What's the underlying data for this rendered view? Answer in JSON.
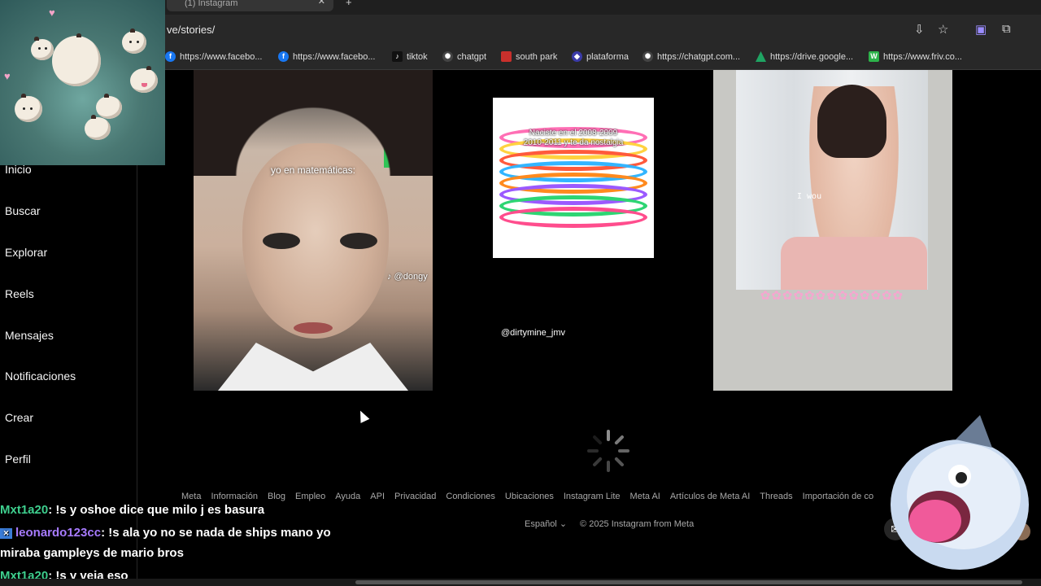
{
  "browser": {
    "tab_title": "(1) Instagram",
    "url": "ve/stories/",
    "bookmarks": [
      {
        "label": "https://www.facebo...",
        "icon": "facebook-icon",
        "color": "#1877f2"
      },
      {
        "label": "https://www.facebo...",
        "icon": "facebook-icon",
        "color": "#1877f2"
      },
      {
        "label": "tiktok",
        "icon": "tiktok-icon",
        "color": "#111111"
      },
      {
        "label": "chatgpt",
        "icon": "chatgpt-icon",
        "color": "#444444"
      },
      {
        "label": "south park",
        "icon": "south-park-icon",
        "color": "#c9302c"
      },
      {
        "label": "plataforma",
        "icon": "plataforma-icon",
        "color": "#3a3aa8"
      },
      {
        "label": "https://chatgpt.com...",
        "icon": "chatgpt-icon",
        "color": "#444444"
      },
      {
        "label": "https://drive.google...",
        "icon": "google-drive-icon",
        "color": "#1fa463"
      },
      {
        "label": "https://www.friv.co...",
        "icon": "friv-icon",
        "color": "#2db34a"
      }
    ]
  },
  "sidebar": {
    "items": [
      {
        "label": "Inicio"
      },
      {
        "label": "Buscar"
      },
      {
        "label": "Explorar"
      },
      {
        "label": "Reels"
      },
      {
        "label": "Mensajes"
      },
      {
        "label": "Notificaciones"
      },
      {
        "label": "Crear"
      },
      {
        "label": "Perfil"
      }
    ]
  },
  "posts": {
    "post1": {
      "caption": "yo en matemáticas:",
      "tag": "♪ @dongy"
    },
    "post2": {
      "caption_line1": "Naciste en el 2008-2009",
      "caption_line2": "2010-2011 y te da nostalgia",
      "username": "@dirtymine_jmv"
    },
    "post3": {
      "overlay_text": "I wou"
    }
  },
  "footer": {
    "links": [
      "Meta",
      "Información",
      "Blog",
      "Empleo",
      "Ayuda",
      "API",
      "Privacidad",
      "Condiciones",
      "Ubicaciones",
      "Instagram Lite",
      "Meta AI",
      "Artículos de Meta AI",
      "Threads",
      "Importación de co"
    ],
    "language": "Español",
    "copyright": "© 2025 Instagram from Meta"
  },
  "chat": [
    {
      "user": "Mxt1a20",
      "text": ": !s y oshoe dice que milo j es basura"
    },
    {
      "user": "leonardo123cc",
      "text": ": !s ala yo no se nada de ships mano yo"
    },
    {
      "user": "",
      "text": "miraba gampleys de mario bros"
    },
    {
      "user": "Mxt1a20",
      "text": ": !s y veia eso"
    }
  ]
}
